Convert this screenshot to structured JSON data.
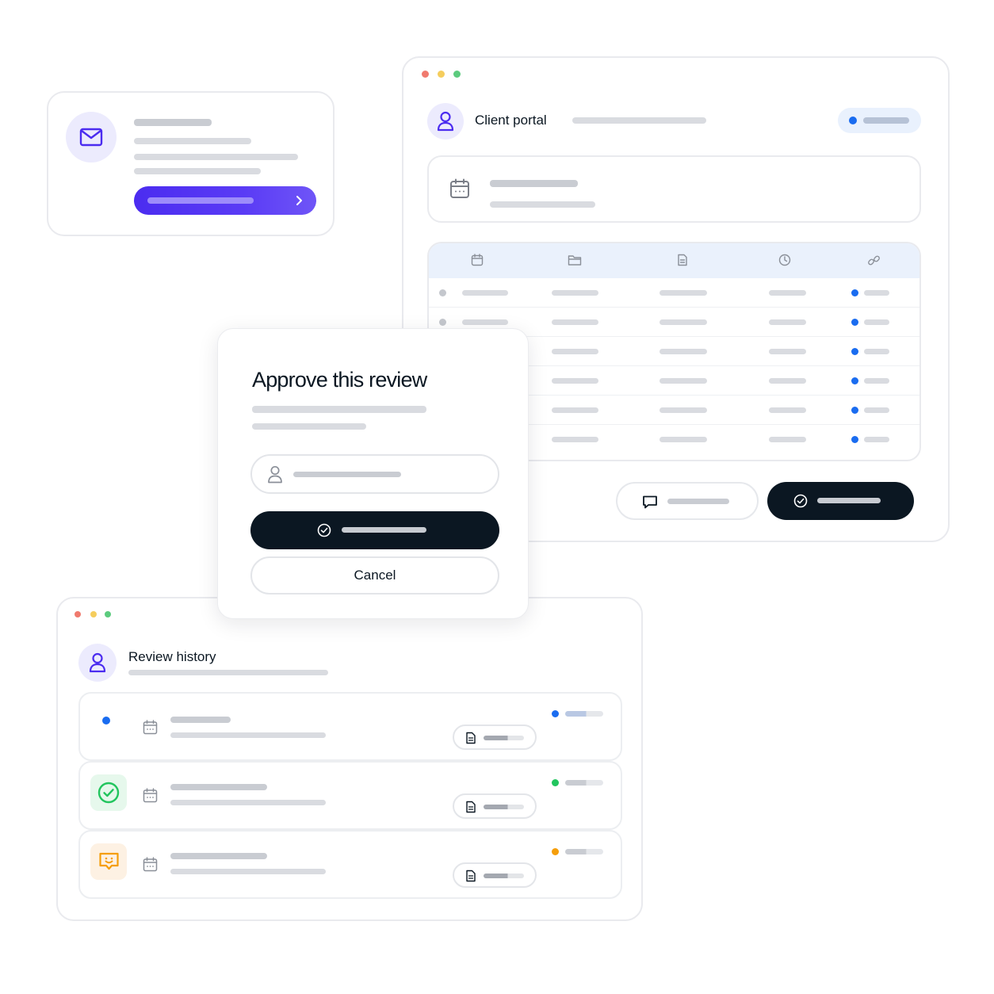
{
  "portal": {
    "title": "Client portal",
    "window_controls": [
      "close",
      "minimize",
      "maximize"
    ],
    "status_indicator_color": "#1a6cf0",
    "date_icon": "calendar-icon",
    "table_column_icons": [
      "calendar-icon",
      "folder-icon",
      "document-icon",
      "clock-icon",
      "link-icon"
    ],
    "table_rows": 6,
    "actions": {
      "comment_icon": "comment-icon",
      "approve_icon": "check-circle-icon"
    }
  },
  "email_card": {
    "icon": "mail-icon",
    "cta_icon": "chevron-right-icon",
    "accent": "#4b2cf0"
  },
  "modal": {
    "title": "Approve this review",
    "name_icon": "user-icon",
    "confirm_icon": "check-circle-icon",
    "cancel_label": "Cancel"
  },
  "history": {
    "title": "Review history",
    "rows": [
      {
        "status": "pending",
        "status_color": "#1a6cf0",
        "tile_icon": "dot-icon"
      },
      {
        "status": "approved",
        "status_color": "#22c55e",
        "tile_icon": "check-circle-icon"
      },
      {
        "status": "changes-requested",
        "status_color": "#f59e0b",
        "tile_icon": "feedback-icon"
      }
    ]
  },
  "colors": {
    "dark": "#0b1722",
    "accent": "#4b2cf0",
    "blue": "#1a6cf0",
    "green": "#22c55e",
    "orange": "#f59e0b"
  }
}
